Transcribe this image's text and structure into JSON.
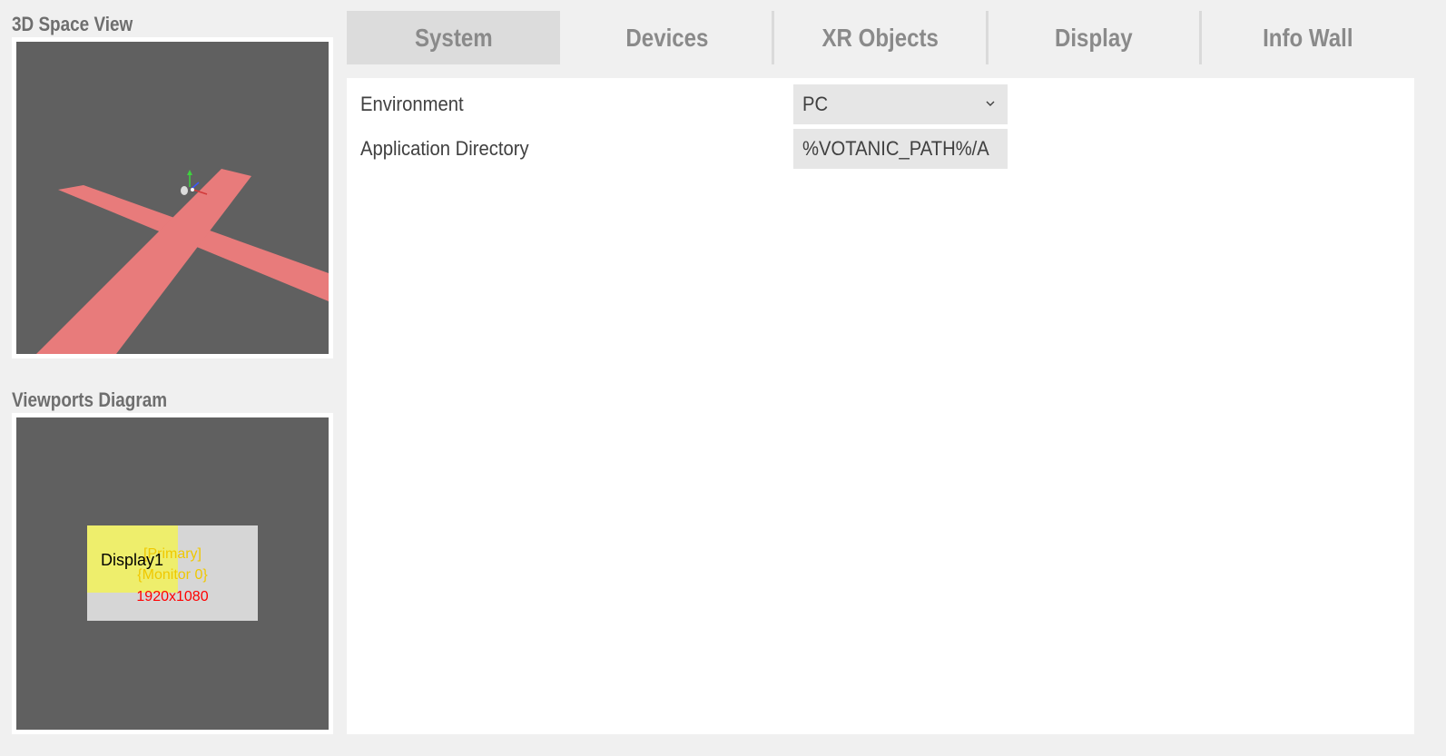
{
  "left_panel": {
    "space_view_title": "3D Space View",
    "viewports_title": "Viewports Diagram",
    "diagram": {
      "display_name": "Display1",
      "primary_label": "[Primary]",
      "monitor_label": "{Monitor 0}",
      "resolution_label": "1920x1080"
    }
  },
  "tabs": [
    {
      "label": "System",
      "active": true
    },
    {
      "label": "Devices",
      "active": false
    },
    {
      "label": "XR Objects",
      "active": false
    },
    {
      "label": "Display",
      "active": false
    },
    {
      "label": "Info Wall",
      "active": false
    }
  ],
  "settings": {
    "environment": {
      "label": "Environment",
      "value": "PC"
    },
    "app_dir": {
      "label": "Application Directory",
      "value": "%VOTANIC_PATH%/A"
    }
  },
  "colors": {
    "viewport_bg": "#606060",
    "floor_cross": "#e87b7b",
    "display_highlight": "#eeee6c",
    "screen_box": "#d6d6d6",
    "diagram_text_red": "#ff0000",
    "diagram_text_yellow": "#f0c800"
  },
  "icons": {
    "dropdown": "chevron-down-icon",
    "axis_gizmo": "axis-gizmo-icon"
  }
}
